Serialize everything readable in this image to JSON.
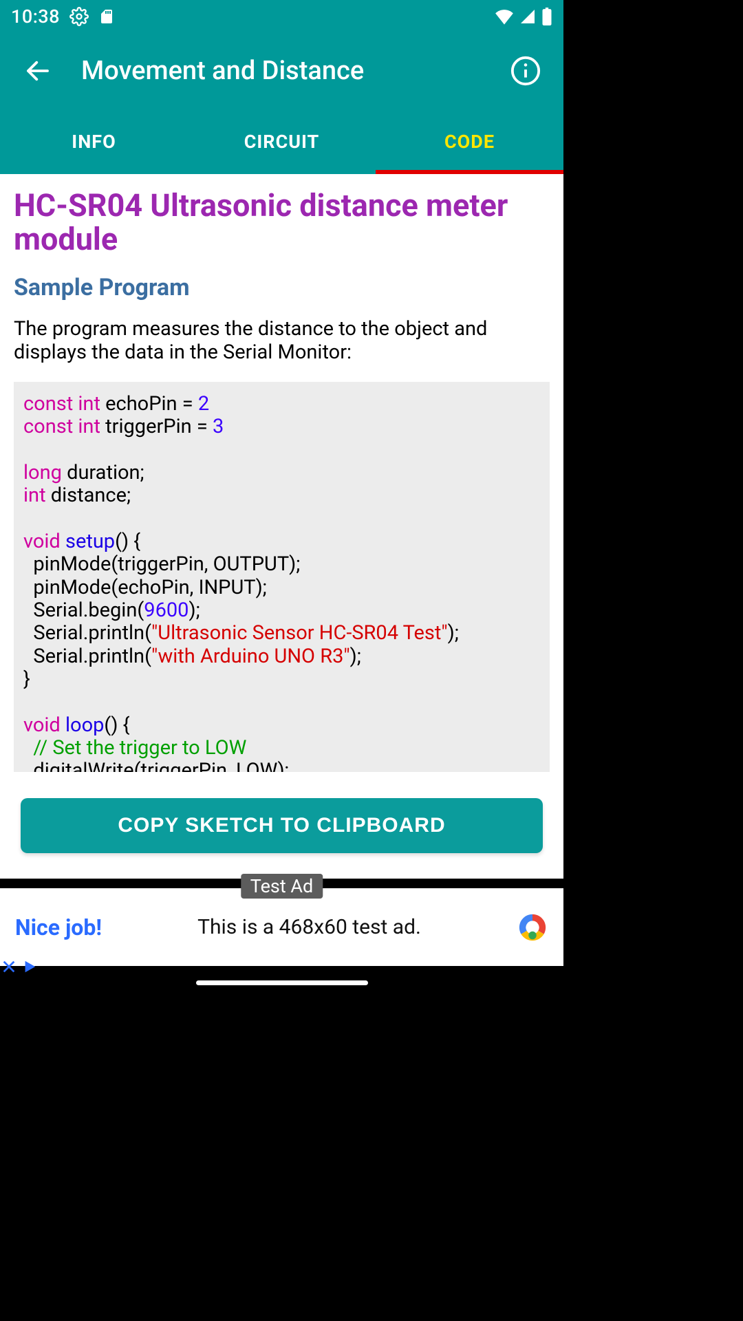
{
  "status": {
    "time": "10:38"
  },
  "appbar": {
    "title": "Movement and Distance"
  },
  "tabs": {
    "info": "INFO",
    "circuit": "CIRCUIT",
    "code": "CODE"
  },
  "content": {
    "title": "HC-SR04 Ultrasonic distance meter module",
    "subtitle": "Sample Program",
    "description": "The program measures the distance to the object and displays the data in the Serial Monitor:"
  },
  "code": {
    "kw_const1": "const int",
    "decl_echo": " echoPin = ",
    "num_echo": "2",
    "kw_const2": "const int",
    "decl_trig": " triggerPin = ",
    "num_trig": "3",
    "kw_long": "long",
    "decl_duration": " duration;",
    "kw_int": "int",
    "decl_distance": " distance;",
    "kw_void1": "void ",
    "fn_setup": "setup",
    "paren_setup": "() {",
    "body_setup1": "  pinMode(triggerPin, OUTPUT);",
    "body_setup2": "  pinMode(echoPin, INPUT);",
    "body_setup3a": "  Serial.begin(",
    "num_baud": "9600",
    "body_setup3b": ");",
    "body_setup4a": "  Serial.println(",
    "str1": "\"Ultrasonic Sensor HC-SR04 Test\"",
    "body_setup4b": ");",
    "body_setup5a": "  Serial.println(",
    "str2": "\"with Arduino UNO R3\"",
    "body_setup5b": ");",
    "brace_close1": "}",
    "kw_void2": "void ",
    "fn_loop": "loop",
    "paren_loop": "() {",
    "comment1": "  // Set the trigger to LOW",
    "body_loop1": "  digitalWrite(triggerPin, LOW);"
  },
  "copy_button": "COPY SKETCH TO CLIPBOARD",
  "ad": {
    "badge": "Test Ad",
    "headline": "Nice job!",
    "text": "This is a 468x60 test ad."
  }
}
